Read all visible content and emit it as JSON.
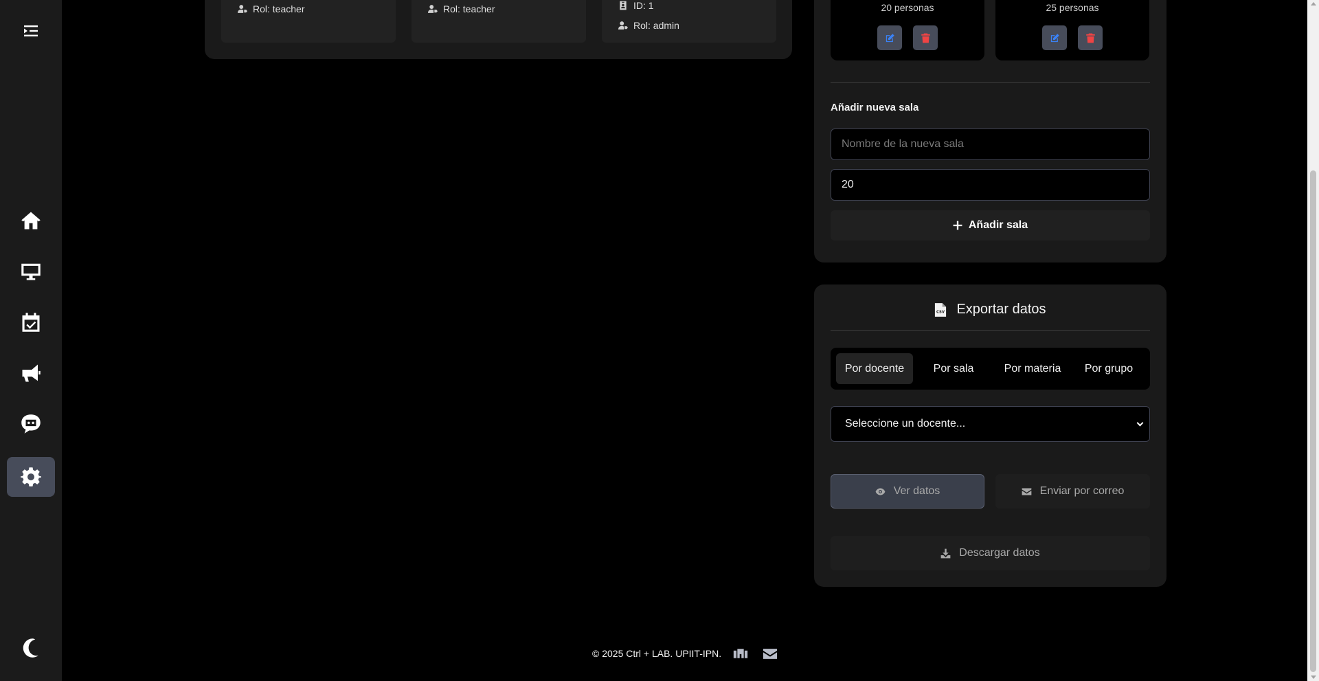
{
  "sidebar": {
    "items": [
      {
        "name": "menu-toggle",
        "icon": "indent-icon"
      },
      {
        "name": "home",
        "icon": "home-icon"
      },
      {
        "name": "computers",
        "icon": "monitor-icon"
      },
      {
        "name": "calendar",
        "icon": "calendar-check-icon"
      },
      {
        "name": "announcements",
        "icon": "megaphone-icon"
      },
      {
        "name": "chat",
        "icon": "chat-bot-icon"
      },
      {
        "name": "settings",
        "icon": "gear-icon",
        "active": true
      },
      {
        "name": "theme",
        "icon": "moon-icon"
      }
    ]
  },
  "users": {
    "cards": [
      {
        "role": "Rol: teacher"
      },
      {
        "role": "Rol: teacher"
      },
      {
        "id": "ID: 1",
        "role": "Rol: admin"
      }
    ]
  },
  "rooms": {
    "cards": [
      {
        "capacity": "20 personas"
      },
      {
        "capacity": "25 personas"
      }
    ],
    "add_section_title": "Añadir nueva sala",
    "name_placeholder": "Nombre de la nueva sala",
    "capacity_value": "20",
    "add_button": "Añadir sala"
  },
  "export": {
    "title": "Exportar datos",
    "tabs": [
      "Por docente",
      "Por sala",
      "Por materia",
      "Por grupo"
    ],
    "active_tab": "Por docente",
    "select_value": "Seleccione un docente...",
    "view_button": "Ver datos",
    "email_button": "Enviar por correo",
    "download_button": "Descargar datos"
  },
  "footer": {
    "copyright": "© 2025 Ctrl + LAB. UPIIT-IPN."
  },
  "colors": {
    "background": "#000000",
    "panel": "#1a1a1a",
    "sidebar": "#1b1b1b",
    "active_item": "#474c5a",
    "edit_accent": "#3b82f6",
    "delete_accent": "#ef4444"
  }
}
